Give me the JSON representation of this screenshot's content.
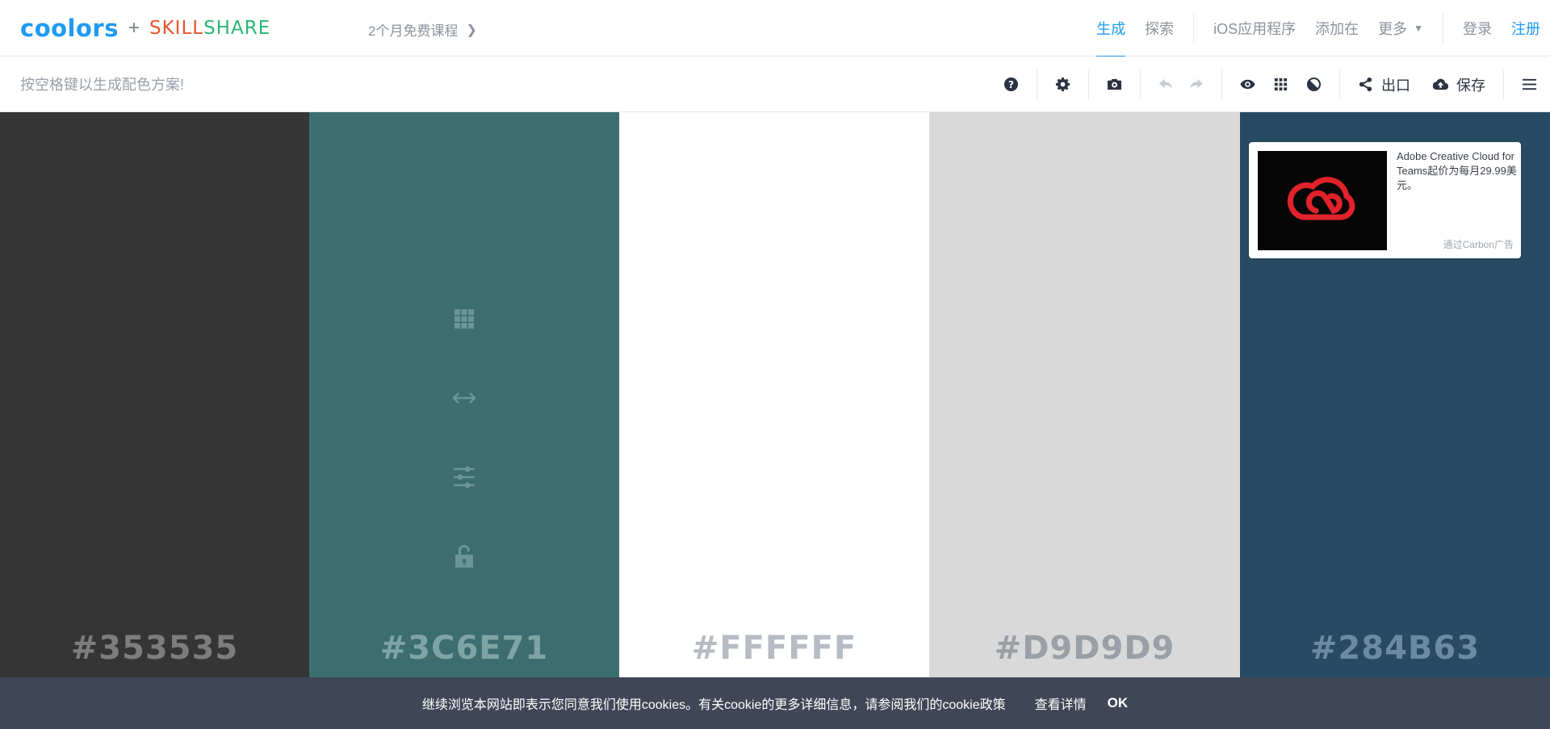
{
  "header": {
    "logo_main": "coolors",
    "logo_plus": "+",
    "logo_partner_a": "SKILL",
    "logo_partner_b": "SHARE",
    "promo": "2个月免费课程",
    "nav": {
      "generate": "生成",
      "explore": "探索",
      "ios_app": "iOS应用程序",
      "add_to": "添加在",
      "more": "更多",
      "login": "登录",
      "signup": "注册"
    }
  },
  "toolbar": {
    "hint": "按空格键以生成配色方案!",
    "export_label": "出口",
    "save_label": "保存",
    "icons": [
      "question-icon",
      "gear-icon",
      "camera-icon",
      "undo-icon",
      "redo-icon",
      "eye-icon",
      "grid-icon",
      "contrast-icon",
      "share-icon",
      "cloud-upload-icon",
      "menu-icon"
    ]
  },
  "palette": {
    "swatches": [
      {
        "hex": "#353535",
        "bg": "#353535",
        "text_color": "#7d7d7d"
      },
      {
        "hex": "#3C6E71",
        "bg": "#3c6e71",
        "text_color": "#7fa4a6"
      },
      {
        "hex": "#FFFFFF",
        "bg": "#ffffff",
        "text_color": "#b7bcc4"
      },
      {
        "hex": "#D9D9D9",
        "bg": "#d9d9d9",
        "text_color": "#9aa0a6"
      },
      {
        "hex": "#284B63",
        "bg": "#284b63",
        "text_color": "#6c8aa0"
      }
    ],
    "hover_tools": [
      "grid-icon",
      "drag-arrows-icon",
      "sliders-icon",
      "lock-open-icon"
    ]
  },
  "ad": {
    "text": "Adobe Creative Cloud for Teams起价为每月29.99美元。",
    "via": "通过Carbon广告",
    "logo_color": "#e1222a"
  },
  "cookie": {
    "message": "继续浏览本网站即表示您同意我们使用cookies。有关cookie的更多详细信息，请参阅我们的cookie政策",
    "details": "查看详情",
    "ok": "OK"
  },
  "colors": {
    "accent": "#1e9bf0",
    "cookie_bg": "#3f4756"
  }
}
